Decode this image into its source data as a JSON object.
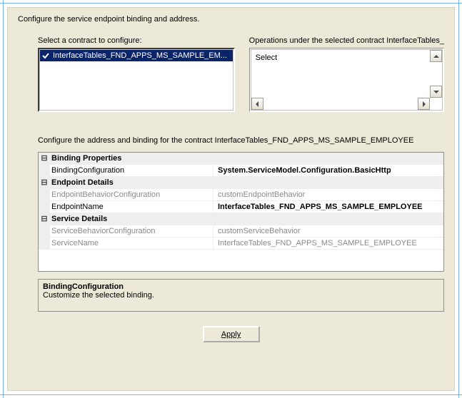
{
  "header": {
    "title": "Configure the service endpoint binding and address."
  },
  "contracts": {
    "label": "Select a contract to configure:",
    "items": [
      {
        "text": "InterfaceTables_FND_APPS_MS_SAMPLE_EM...",
        "selected": true
      }
    ]
  },
  "operations": {
    "label": "Operations under the selected contract  InterfaceTables_",
    "items": [
      {
        "text": "Select"
      }
    ]
  },
  "bindingSection": {
    "label": "Configure the address and binding for the contract  InterfaceTables_FND_APPS_MS_SAMPLE_EMPLOYEE"
  },
  "propertyGrid": {
    "categories": [
      {
        "name": "Binding Properties",
        "rows": [
          {
            "name": "BindingConfiguration",
            "value": "System.ServiceModel.Configuration.BasicHttp",
            "bold": true
          }
        ]
      },
      {
        "name": "Endpoint Details",
        "rows": [
          {
            "name": "EndpointBehaviorConfiguration",
            "value": "customEndpointBehavior",
            "dim": true
          },
          {
            "name": "EndpointName",
            "value": "InterfaceTables_FND_APPS_MS_SAMPLE_EMPLOYEE",
            "bold": true
          }
        ]
      },
      {
        "name": "Service Details",
        "rows": [
          {
            "name": "ServiceBehaviorConfiguration",
            "value": "customServiceBehavior",
            "dim": true
          },
          {
            "name": "ServiceName",
            "value": "InterfaceTables_FND_APPS_MS_SAMPLE_EMPLOYEE",
            "dim": true
          }
        ]
      }
    ]
  },
  "description": {
    "title": "BindingConfiguration",
    "text": "Customize the selected binding."
  },
  "buttons": {
    "apply": "Apply"
  },
  "glyphs": {
    "minus": "⊟"
  }
}
